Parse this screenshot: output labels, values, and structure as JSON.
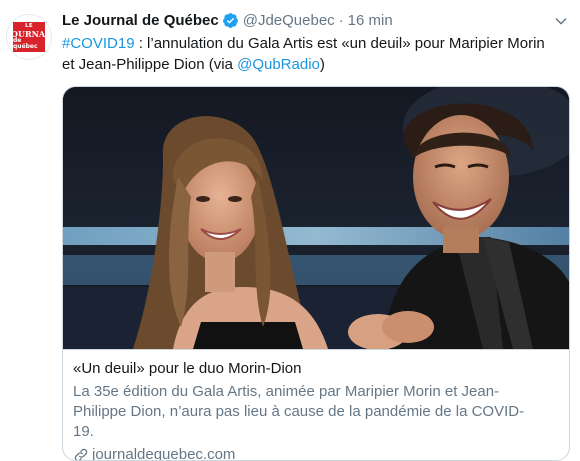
{
  "tweet": {
    "avatar": {
      "logo_lines": [
        "Le",
        "Journal",
        "de Québec"
      ],
      "logo_color": "#d8232a"
    },
    "display_name": "Le Journal de Québec",
    "verified": true,
    "handle": "@JdeQuebec",
    "separator": "·",
    "timestamp": "16 min",
    "menu_icon": "chevron-down-icon",
    "text": {
      "hashtag": "#COVID19",
      "body": " : l’annulation du Gala Artis est «un deuil» pour Maripier Morin et Jean-Philippe Dion (via ",
      "mention": "@QubRadio",
      "suffix": ")"
    },
    "card": {
      "image_alt": "photo",
      "title": "«Un deuil» pour le duo Morin-Dion",
      "description": "La 35e édition du Gala Artis, animée par Maripier Morin et Jean-Philippe Dion, n’aura pas lieu à cause de la pandémie de la COVID-19.",
      "domain": "journaldequebec.com",
      "domain_icon": "link-icon"
    }
  },
  "colors": {
    "link": "#1b95e0",
    "secondary_text": "#657786",
    "primary_text": "#14171a",
    "border": "#ccd6dd",
    "verified": "#1da1f2"
  }
}
